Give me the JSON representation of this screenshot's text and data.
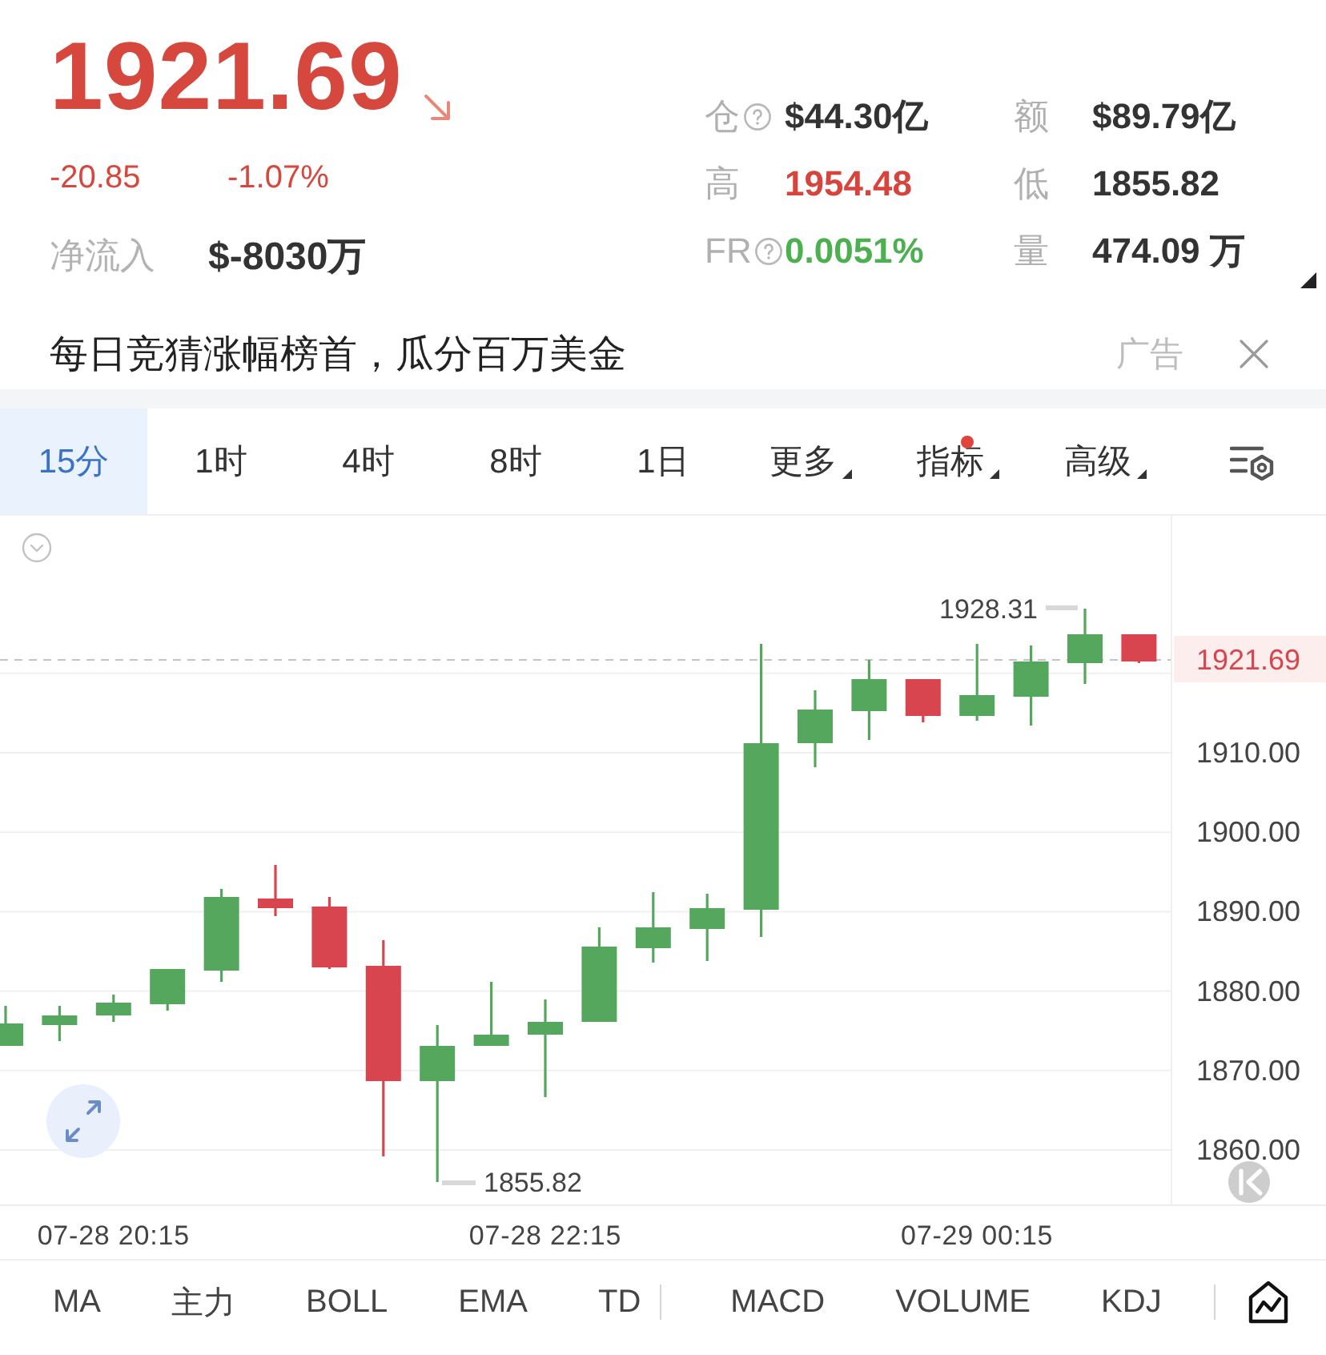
{
  "quote": {
    "price": "1921.69",
    "falling": true,
    "change": "-20.85",
    "change_percent": "-1.07%",
    "net_inflow_label": "净流入",
    "net_inflow": "$-8030万"
  },
  "stats": [
    {
      "label": "仓",
      "help": true,
      "value": "$44.30亿",
      "color": "#333333"
    },
    {
      "label": "额",
      "help": false,
      "value": "$89.79亿",
      "color": "#333333"
    },
    {
      "label": "高",
      "help": false,
      "value": "1954.48",
      "color": "#d6453d"
    },
    {
      "label": "低",
      "help": false,
      "value": "1855.82",
      "color": "#333333"
    },
    {
      "label": "FR",
      "help": true,
      "value": "0.0051%",
      "color": "#4caf50"
    },
    {
      "label": "量",
      "help": false,
      "value": "474.09 万",
      "color": "#333333"
    }
  ],
  "ad": {
    "text": "每日竞猜涨幅榜首，瓜分百万美金",
    "tag": "广告"
  },
  "periods": [
    {
      "label": "15分",
      "selected": true,
      "dropdown": false,
      "dot": false
    },
    {
      "label": "1时",
      "selected": false,
      "dropdown": false,
      "dot": false
    },
    {
      "label": "4时",
      "selected": false,
      "dropdown": false,
      "dot": false
    },
    {
      "label": "8时",
      "selected": false,
      "dropdown": false,
      "dot": false
    },
    {
      "label": "1日",
      "selected": false,
      "dropdown": false,
      "dot": false
    },
    {
      "label": "更多",
      "selected": false,
      "dropdown": true,
      "dot": false
    },
    {
      "label": "指标",
      "selected": false,
      "dropdown": true,
      "dot": true
    },
    {
      "label": "高级",
      "selected": false,
      "dropdown": true,
      "dot": false
    }
  ],
  "chart": {
    "y_axis": [
      "1910.00",
      "1900.00",
      "1890.00",
      "1880.00",
      "1870.00",
      "1860.00"
    ],
    "x_axis": [
      "07-28 20:15",
      "07-28 22:15",
      "07-29 00:15"
    ],
    "last_price": "1921.69",
    "high_marker": "1928.31",
    "low_marker": "1855.82"
  },
  "indicator_groups": [
    [
      "MA",
      "主力",
      "BOLL",
      "EMA",
      "TD"
    ],
    [
      "MACD",
      "VOLUME",
      "KDJ"
    ]
  ]
}
